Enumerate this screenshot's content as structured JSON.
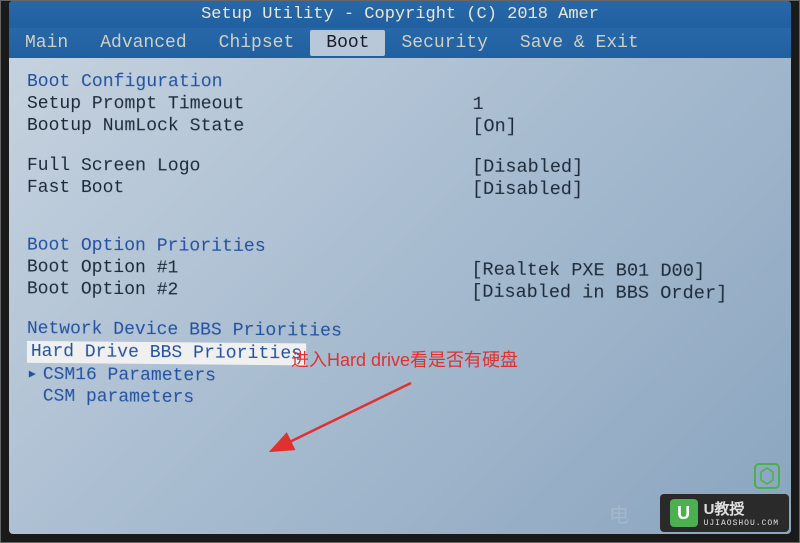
{
  "title": "Setup Utility - Copyright (C) 2018 Amer",
  "menu": {
    "items": [
      "Main",
      "Advanced",
      "Chipset",
      "Boot",
      "Security",
      "Save & Exit"
    ],
    "active_index": 3
  },
  "sections": {
    "boot_config": {
      "header": "Boot Configuration",
      "setup_prompt_label": "Setup Prompt Timeout",
      "setup_prompt_value": "1",
      "numlock_label": "Bootup NumLock State",
      "numlock_value": "[On]",
      "logo_label": "Full Screen Logo",
      "logo_value": "[Disabled]",
      "fastboot_label": "Fast Boot",
      "fastboot_value": "[Disabled]"
    },
    "boot_priorities": {
      "header": "Boot Option Priorities",
      "option1_label": "Boot Option #1",
      "option1_value": "[Realtek PXE B01 D00]",
      "option2_label": "Boot Option #2",
      "option2_value": "[Disabled in BBS Order]"
    },
    "submenus": {
      "network": "Network Device BBS Priorities",
      "harddrive": "Hard Drive BBS Priorities",
      "csm16": "CSM16 Parameters",
      "csm": "CSM parameters"
    }
  },
  "annotation": "进入Hard drive看是否有硬盘",
  "watermark": {
    "icon_letter": "U",
    "main": "U教授",
    "sub": "UJIAOSHOU.COM",
    "ghost": "电"
  }
}
